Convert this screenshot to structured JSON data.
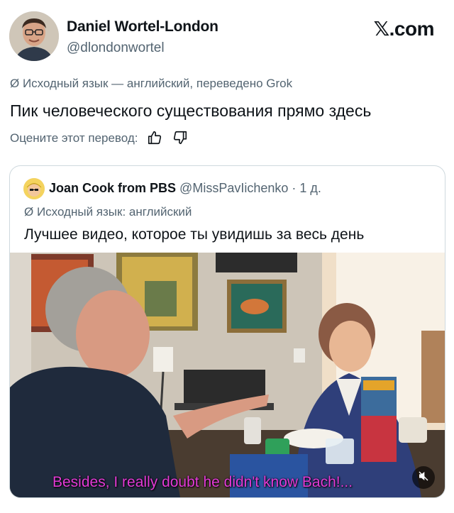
{
  "post": {
    "author": {
      "name": "Daniel Wortel-London",
      "handle": "@dlondonwortel"
    },
    "brand": "𝕏.com",
    "translation_note": "Ø Исходный язык — английский, переведено Grok",
    "text": "Пик человеческого существования прямо здесь",
    "rate_prompt": "Оцените этот перевод:"
  },
  "quote": {
    "author_name": "Joan Cook from PBS",
    "meta": "@MissPavIichenko · 1 д.",
    "translation_note": "Ø Исходный язык: английский",
    "text": "Лучшее видео, которое ты увидишь за весь день",
    "video": {
      "subtitle": "Besides, I really doubt he didn't know Bach!...",
      "subtitle_color": "#e33ad6"
    }
  },
  "icons": [
    "thumbs-up-icon",
    "thumbs-down-icon",
    "mute-icon"
  ],
  "colors": {
    "text_primary": "#0f1419",
    "text_secondary": "#536471",
    "border": "#cfd9de"
  }
}
